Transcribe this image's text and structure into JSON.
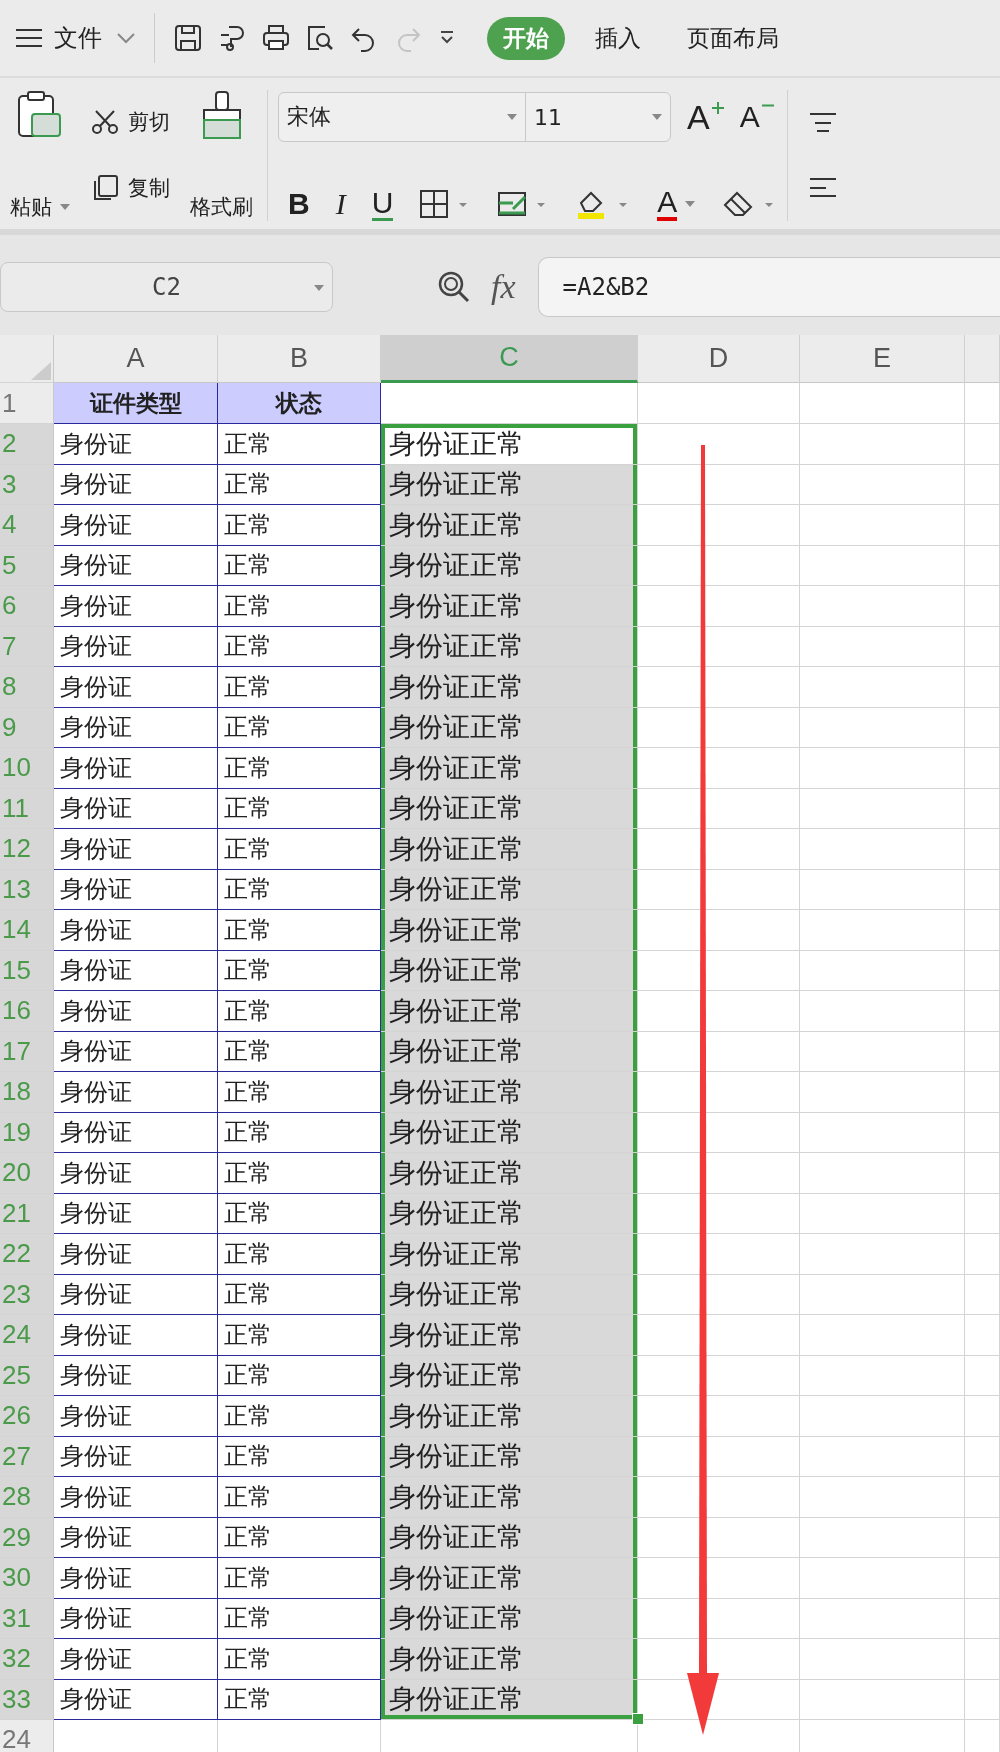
{
  "menu_bar": {
    "file_menu": "文件",
    "tabs": [
      {
        "label": "开始",
        "selected": true
      },
      {
        "label": "插入",
        "selected": false
      },
      {
        "label": "页面布局",
        "selected": false
      }
    ]
  },
  "ribbon": {
    "paste": "粘贴",
    "cut": "剪切",
    "copy": "复制",
    "format_painter": "格式刷",
    "font": "宋体",
    "font_size": "11",
    "bold": "B",
    "italic": "I",
    "underline": "U",
    "grow": "A",
    "shrink": "A",
    "font_color": "A"
  },
  "formula_bar": {
    "name_box": "C2",
    "fx": "fx",
    "formula": "=A2&B2"
  },
  "columns": [
    {
      "label": "A",
      "selected": false
    },
    {
      "label": "B",
      "selected": false
    },
    {
      "label": "C",
      "selected": true
    },
    {
      "label": "D",
      "selected": false
    },
    {
      "label": "E",
      "selected": false
    }
  ],
  "rows": [
    {
      "num": "1",
      "kind": "header",
      "selected": false,
      "active": false,
      "a": "证件类型",
      "b": "状态",
      "c": ""
    },
    {
      "num": "2",
      "kind": "data",
      "selected": true,
      "active": true,
      "a": "身份证",
      "b": "正常",
      "c": "身份证正常"
    },
    {
      "num": "3",
      "kind": "data",
      "selected": true,
      "active": false,
      "a": "身份证",
      "b": "正常",
      "c": "身份证正常"
    },
    {
      "num": "4",
      "kind": "data",
      "selected": true,
      "active": false,
      "a": "身份证",
      "b": "正常",
      "c": "身份证正常"
    },
    {
      "num": "5",
      "kind": "data",
      "selected": true,
      "active": false,
      "a": "身份证",
      "b": "正常",
      "c": "身份证正常"
    },
    {
      "num": "6",
      "kind": "data",
      "selected": true,
      "active": false,
      "a": "身份证",
      "b": "正常",
      "c": "身份证正常"
    },
    {
      "num": "7",
      "kind": "data",
      "selected": true,
      "active": false,
      "a": "身份证",
      "b": "正常",
      "c": "身份证正常"
    },
    {
      "num": "8",
      "kind": "data",
      "selected": true,
      "active": false,
      "a": "身份证",
      "b": "正常",
      "c": "身份证正常"
    },
    {
      "num": "9",
      "kind": "data",
      "selected": true,
      "active": false,
      "a": "身份证",
      "b": "正常",
      "c": "身份证正常"
    },
    {
      "num": "10",
      "kind": "data",
      "selected": true,
      "active": false,
      "a": "身份证",
      "b": "正常",
      "c": "身份证正常"
    },
    {
      "num": "11",
      "kind": "data",
      "selected": true,
      "active": false,
      "a": "身份证",
      "b": "正常",
      "c": "身份证正常"
    },
    {
      "num": "12",
      "kind": "data",
      "selected": true,
      "active": false,
      "a": "身份证",
      "b": "正常",
      "c": "身份证正常"
    },
    {
      "num": "13",
      "kind": "data",
      "selected": true,
      "active": false,
      "a": "身份证",
      "b": "正常",
      "c": "身份证正常"
    },
    {
      "num": "14",
      "kind": "data",
      "selected": true,
      "active": false,
      "a": "身份证",
      "b": "正常",
      "c": "身份证正常"
    },
    {
      "num": "15",
      "kind": "data",
      "selected": true,
      "active": false,
      "a": "身份证",
      "b": "正常",
      "c": "身份证正常"
    },
    {
      "num": "16",
      "kind": "data",
      "selected": true,
      "active": false,
      "a": "身份证",
      "b": "正常",
      "c": "身份证正常"
    },
    {
      "num": "17",
      "kind": "data",
      "selected": true,
      "active": false,
      "a": "身份证",
      "b": "正常",
      "c": "身份证正常"
    },
    {
      "num": "18",
      "kind": "data",
      "selected": true,
      "active": false,
      "a": "身份证",
      "b": "正常",
      "c": "身份证正常"
    },
    {
      "num": "19",
      "kind": "data",
      "selected": true,
      "active": false,
      "a": "身份证",
      "b": "正常",
      "c": "身份证正常"
    },
    {
      "num": "20",
      "kind": "data",
      "selected": true,
      "active": false,
      "a": "身份证",
      "b": "正常",
      "c": "身份证正常"
    },
    {
      "num": "21",
      "kind": "data",
      "selected": true,
      "active": false,
      "a": "身份证",
      "b": "正常",
      "c": "身份证正常"
    },
    {
      "num": "22",
      "kind": "data",
      "selected": true,
      "active": false,
      "a": "身份证",
      "b": "正常",
      "c": "身份证正常"
    },
    {
      "num": "23",
      "kind": "data",
      "selected": true,
      "active": false,
      "a": "身份证",
      "b": "正常",
      "c": "身份证正常"
    },
    {
      "num": "24",
      "kind": "data",
      "selected": true,
      "active": false,
      "a": "身份证",
      "b": "正常",
      "c": "身份证正常"
    },
    {
      "num": "25",
      "kind": "data",
      "selected": true,
      "active": false,
      "a": "身份证",
      "b": "正常",
      "c": "身份证正常"
    },
    {
      "num": "26",
      "kind": "data",
      "selected": true,
      "active": false,
      "a": "身份证",
      "b": "正常",
      "c": "身份证正常"
    },
    {
      "num": "27",
      "kind": "data",
      "selected": true,
      "active": false,
      "a": "身份证",
      "b": "正常",
      "c": "身份证正常"
    },
    {
      "num": "28",
      "kind": "data",
      "selected": true,
      "active": false,
      "a": "身份证",
      "b": "正常",
      "c": "身份证正常"
    },
    {
      "num": "29",
      "kind": "data",
      "selected": true,
      "active": false,
      "a": "身份证",
      "b": "正常",
      "c": "身份证正常"
    },
    {
      "num": "30",
      "kind": "data",
      "selected": true,
      "active": false,
      "a": "身份证",
      "b": "正常",
      "c": "身份证正常"
    },
    {
      "num": "31",
      "kind": "data",
      "selected": true,
      "active": false,
      "a": "身份证",
      "b": "正常",
      "c": "身份证正常"
    },
    {
      "num": "32",
      "kind": "data",
      "selected": true,
      "active": false,
      "a": "身份证",
      "b": "正常",
      "c": "身份证正常"
    },
    {
      "num": "33",
      "kind": "data",
      "selected": true,
      "active": false,
      "a": "身份证",
      "b": "正常",
      "c": "身份证正常"
    },
    {
      "num": "24",
      "kind": "empty",
      "selected": false,
      "active": false,
      "a": "",
      "b": "",
      "c": ""
    }
  ]
}
